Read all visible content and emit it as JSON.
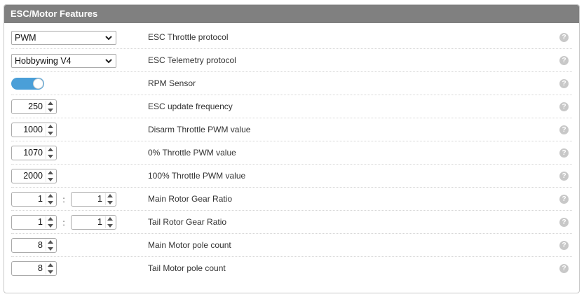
{
  "panel": {
    "title": "ESC/Motor Features",
    "help_glyph": "?"
  },
  "rows": [
    {
      "type": "select",
      "value": "PWM",
      "label": "ESC Throttle protocol"
    },
    {
      "type": "select",
      "value": "Hobbywing V4",
      "label": "ESC Telemetry protocol"
    },
    {
      "type": "toggle",
      "state": "on",
      "label": "RPM Sensor"
    },
    {
      "type": "number",
      "value": "250",
      "label": "ESC update frequency"
    },
    {
      "type": "number",
      "value": "1000",
      "label": "Disarm Throttle PWM value"
    },
    {
      "type": "number",
      "value": "1070",
      "label": "0% Throttle PWM value"
    },
    {
      "type": "number",
      "value": "2000",
      "label": "100% Throttle PWM value"
    },
    {
      "type": "ratio",
      "left": "1",
      "separator": ":",
      "right": "1",
      "label": "Main Rotor Gear Ratio"
    },
    {
      "type": "ratio",
      "left": "1",
      "separator": ":",
      "right": "1",
      "label": "Tail Rotor Gear Ratio"
    },
    {
      "type": "number",
      "value": "8",
      "label": "Main Motor pole count"
    },
    {
      "type": "number",
      "value": "8",
      "label": "Tail Motor pole count"
    }
  ],
  "colors": {
    "header_bg": "#808080",
    "toggle_on": "#4a9fd8",
    "help_icon": "#c8c8c8"
  },
  "icons": {
    "select_chevron": "chevron-down-icon",
    "help": "help-icon",
    "spinner": "spinner-arrows-icon"
  }
}
